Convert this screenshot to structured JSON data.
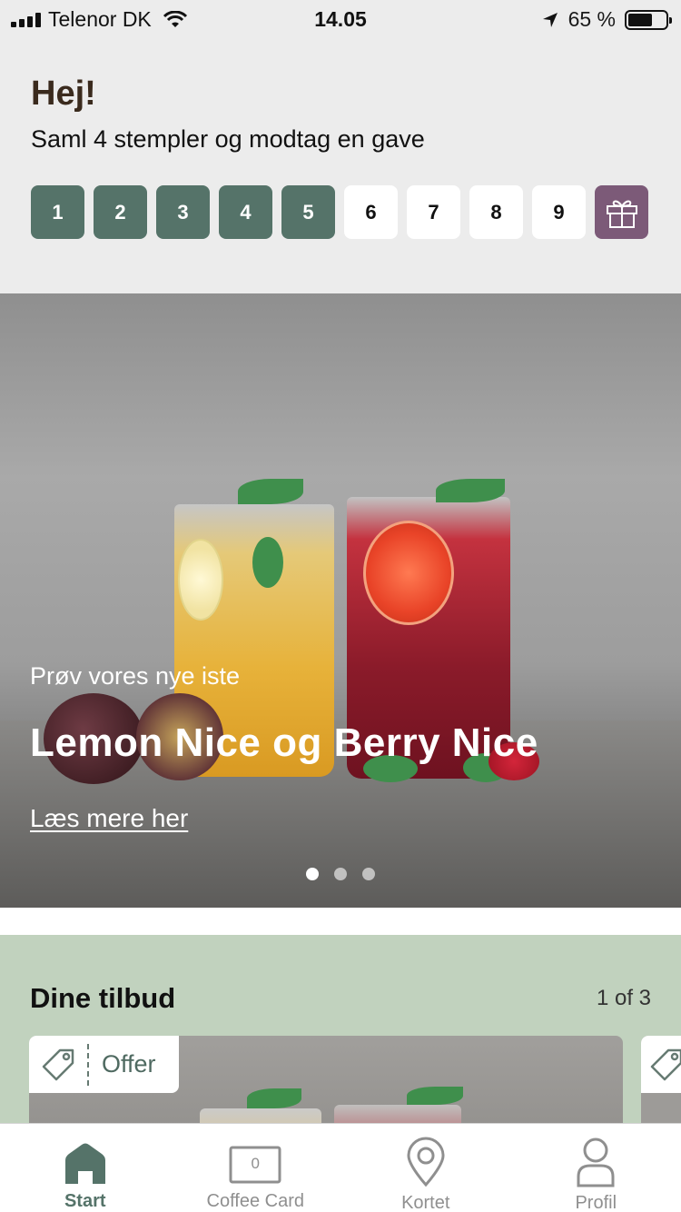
{
  "status_bar": {
    "carrier": "Telenor DK",
    "time": "14.05",
    "battery": "65 %",
    "battery_level": 0.65
  },
  "header": {
    "greeting": "Hej!",
    "subtitle": "Saml 4 stempler og modtag en gave"
  },
  "stamps": {
    "items": [
      "1",
      "2",
      "3",
      "4",
      "5",
      "6",
      "7",
      "8",
      "9"
    ],
    "filled_count": 5,
    "reward_icon": "gift-icon",
    "filled_color": "#557369",
    "reward_color": "#7c5a78"
  },
  "hero": {
    "kicker": "Prøv vores nye iste",
    "title": "Lemon Nice og Berry Nice",
    "link": "Læs mere her",
    "slides": 3,
    "active_slide": 1
  },
  "offers": {
    "title": "Dine tilbud",
    "count": "1 of 3",
    "tag_label": "Offer",
    "tag_icon": "price-tag-icon",
    "background": "#c1d2be"
  },
  "tabbar": {
    "tabs": [
      {
        "label": "Start",
        "icon": "home-icon",
        "active": true
      },
      {
        "label": "Coffee Card",
        "icon": "coffee-card-icon",
        "badge": "0"
      },
      {
        "label": "Kortet",
        "icon": "map-pin-icon"
      },
      {
        "label": "Profil",
        "icon": "user-icon"
      }
    ],
    "active_color": "#557369"
  }
}
